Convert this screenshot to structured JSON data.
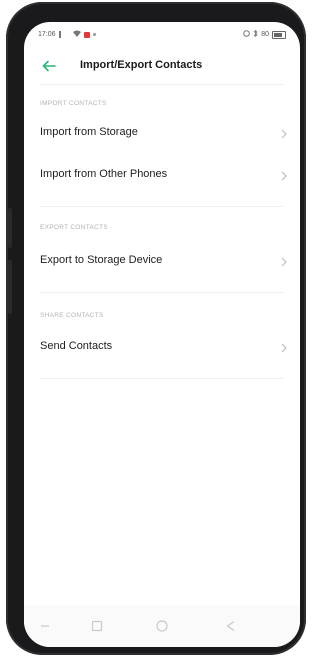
{
  "status_bar": {
    "time": "17:06",
    "battery_text": "80"
  },
  "header": {
    "title": "Import/Export Contacts"
  },
  "sections": [
    {
      "label": "IMPORT CONTACTS",
      "items": [
        {
          "label": "Import from Storage"
        },
        {
          "label": "Import from Other Phones"
        }
      ]
    },
    {
      "label": "EXPORT CONTACTS",
      "items": [
        {
          "label": "Export to Storage Device"
        }
      ]
    },
    {
      "label": "SHARE CONTACTS",
      "items": [
        {
          "label": "Send Contacts"
        }
      ]
    }
  ],
  "colors": {
    "accent": "#2bb673",
    "notification": "#e23a3a"
  },
  "icons": {
    "back": "arrow-left-icon",
    "chevron": "chevron-right-icon",
    "nav_menu": "menu-icon",
    "nav_recents": "square-icon",
    "nav_home": "circle-icon",
    "nav_back": "triangle-back-icon"
  }
}
